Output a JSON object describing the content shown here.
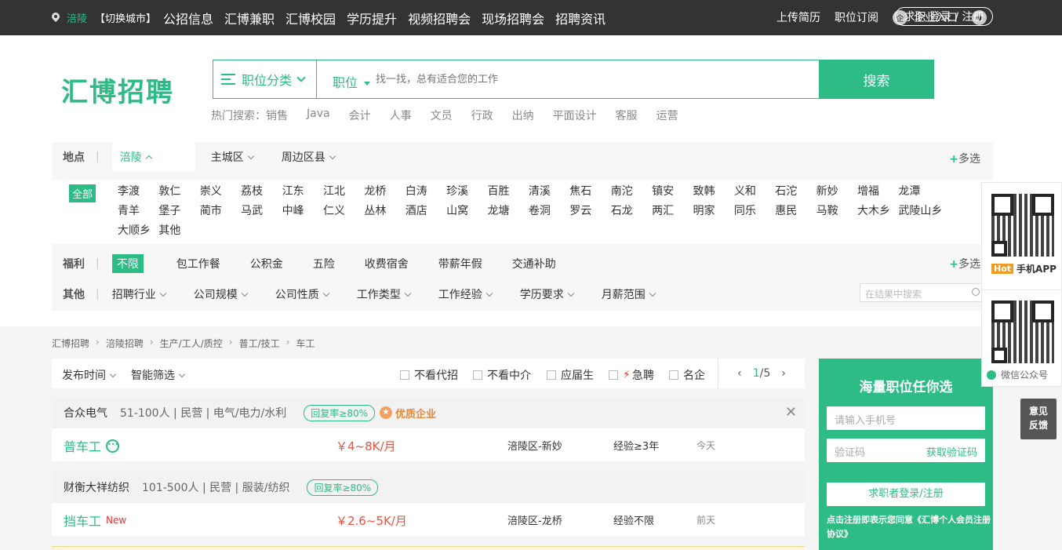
{
  "topbar": {
    "city": "涪陵",
    "switch_city": "【切换城市】",
    "nav": [
      "公招信息",
      "汇博兼职",
      "汇博校园",
      "学历提升",
      "视频招聘会",
      "现场招聘会",
      "招聘资讯"
    ],
    "upload_resume": "上传简历",
    "job_subscribe": "职位订阅",
    "enterprise_entry": "企业入口",
    "login": "求职 登录 / 注册"
  },
  "logo": "汇博招聘",
  "search": {
    "category": "职位分类",
    "type": "职位",
    "placeholder": "找一找，总有适合您的工作",
    "button": "搜索",
    "hot_label": "热门搜索：",
    "hot": [
      "销售",
      "Java",
      "会计",
      "人事",
      "文员",
      "行政",
      "出纳",
      "平面设计",
      "客服",
      "运营"
    ]
  },
  "filters": {
    "location_label": "地点",
    "location_tabs": [
      "涪陵",
      "主城区",
      "周边区县"
    ],
    "multi": "多选",
    "all": "全部",
    "areas": [
      "李渡",
      "敦仁",
      "崇义",
      "荔枝",
      "江东",
      "江北",
      "龙桥",
      "白涛",
      "珍溪",
      "百胜",
      "清溪",
      "焦石",
      "南沱",
      "镇安",
      "致韩",
      "义和",
      "石沱",
      "新妙",
      "增福",
      "龙潭",
      "青羊",
      "堡子",
      "蔺市",
      "马武",
      "中峰",
      "仁义",
      "丛林",
      "酒店",
      "山窝",
      "龙塘",
      "卷洞",
      "罗云",
      "石龙",
      "两汇",
      "明家",
      "同乐",
      "惠民",
      "马鞍",
      "大木乡",
      "武陵山乡",
      "大顺乡",
      "其他"
    ],
    "welfare_label": "福利",
    "welfare": [
      "不限",
      "包工作餐",
      "公积金",
      "五险",
      "收费宿舍",
      "带薪年假",
      "交通补助"
    ],
    "other_label": "其他",
    "other": [
      "招聘行业",
      "公司规模",
      "公司性质",
      "工作类型",
      "工作经验",
      "学历要求",
      "月薪范围"
    ],
    "in_result_placeholder": "在结果中搜索"
  },
  "breadcrumb": [
    "汇博招聘",
    "涪陵招聘",
    "生产/工人/质控",
    "普工/技工",
    "车工"
  ],
  "sortbar": {
    "publish_time": "发布时间",
    "smart_filter": "智能筛选",
    "checks": [
      "不看代招",
      "不看中介",
      "应届生",
      "急聘",
      "名企"
    ],
    "page_current": "1",
    "page_total": "/5"
  },
  "jobs": [
    {
      "company": "合众电气",
      "meta": "51-100人 | 民营 | 电气/电力/水利",
      "reply": "回复率≥80%",
      "quality": "优质企业",
      "title": "普车工",
      "new": "",
      "salary": "￥4~8K/月",
      "place": "涪陵区-新妙",
      "exp": "经验≥3年",
      "date": "今天"
    },
    {
      "company": "财衡大祥纺织",
      "meta": "101-500人 | 民营 | 服装/纺织",
      "reply": "回复率≥80%",
      "quality": "",
      "title": "挡车工",
      "new": "New",
      "salary": "￥2.6~5K/月",
      "place": "涪陵区-龙桥",
      "exp": "经验不限",
      "date": "前天"
    }
  ],
  "register": {
    "title": "海量职位任你选",
    "phone_placeholder": "请输入手机号",
    "code_placeholder": "验证码",
    "get_code": "获取验证码",
    "button": "求职者登录/注册",
    "agreement": "点击注册即表示您同意《汇博个人会员注册协议》"
  },
  "side": {
    "hot": "Hot",
    "app": "手机APP",
    "wechat": "微信公众号",
    "feedback_1": "意见",
    "feedback_2": "反馈"
  }
}
